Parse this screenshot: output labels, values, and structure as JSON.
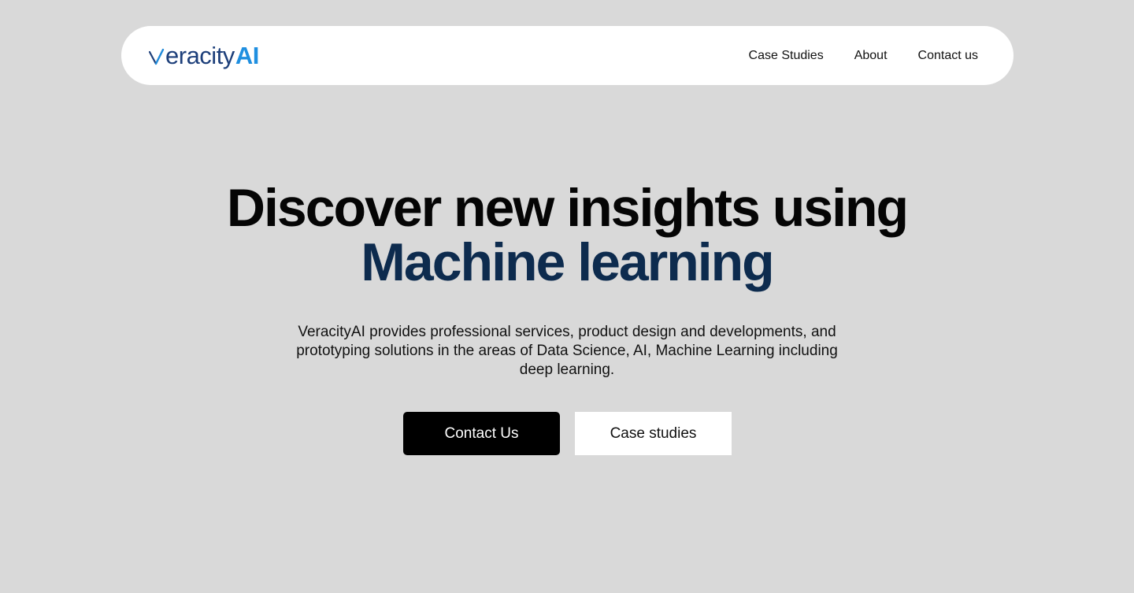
{
  "brand": {
    "name_main": "eracity",
    "name_accent": "AI",
    "color_main": "#1d3f7a",
    "color_accent": "#1f8fe0"
  },
  "nav": {
    "links": [
      {
        "label": "Case Studies"
      },
      {
        "label": "About"
      },
      {
        "label": "Contact us"
      }
    ]
  },
  "hero": {
    "title_line1": "Discover new insights using",
    "title_line2": "Machine learning",
    "title_line2_color": "#0d2b4e",
    "subtitle": "VeracityAI provides professional services, product design and developments, and prototyping solutions in the areas of Data Science, AI, Machine Learning including deep learning.",
    "primary_button": "Contact Us",
    "secondary_button": "Case studies"
  },
  "colors": {
    "page_background": "#d9d9d9",
    "nav_background": "#ffffff",
    "primary_button_bg": "#000000",
    "secondary_button_bg": "#ffffff"
  }
}
